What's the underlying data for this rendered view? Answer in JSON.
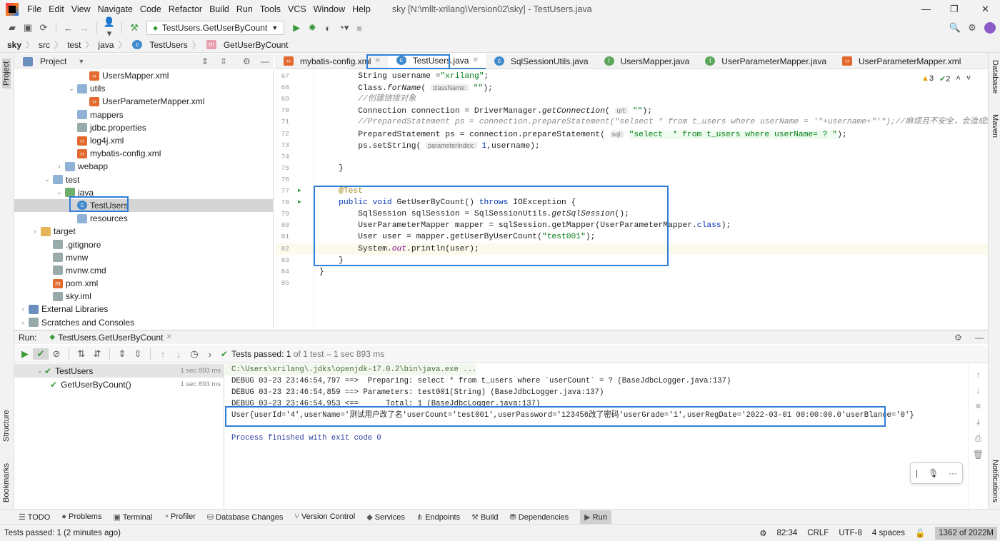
{
  "window": {
    "title": "sky [N:\\mllt-xrilang\\Version02\\sky] - TestUsers.java",
    "controls": [
      "—",
      "❐",
      "✕"
    ]
  },
  "menu": [
    "File",
    "Edit",
    "View",
    "Navigate",
    "Code",
    "Refactor",
    "Build",
    "Run",
    "Tools",
    "VCS",
    "Window",
    "Help"
  ],
  "toolbar": {
    "run_config": "TestUsers.GetUserByCount"
  },
  "breadcrumb": [
    "sky",
    "src",
    "test",
    "java",
    "TestUsers",
    "GetUserByCount"
  ],
  "left_strip": {
    "project": "Project",
    "structure": "Structure",
    "bookmarks": "Bookmarks"
  },
  "right_strip": {
    "database": "Database",
    "maven": "Maven",
    "notifications": "Notifications"
  },
  "project_panel": {
    "title": "Project",
    "tree": [
      {
        "label": "UsersMapper.xml",
        "indent": 5,
        "icon": "xml"
      },
      {
        "label": "utils",
        "indent": 4,
        "icon": "folder",
        "arrow": "open"
      },
      {
        "label": "UserParameterMapper.xml",
        "indent": 5,
        "icon": "xml"
      },
      {
        "label": "mappers",
        "indent": 4,
        "icon": "folder"
      },
      {
        "label": "jdbc.properties",
        "indent": 4,
        "icon": "file"
      },
      {
        "label": "log4j.xml",
        "indent": 4,
        "icon": "xml"
      },
      {
        "label": "mybatis-config.xml",
        "indent": 4,
        "icon": "xml"
      },
      {
        "label": "webapp",
        "indent": 3,
        "icon": "folder",
        "arrow": "closed"
      },
      {
        "label": "test",
        "indent": 2,
        "icon": "folder",
        "arrow": "open"
      },
      {
        "label": "java",
        "indent": 3,
        "icon": "folder-g",
        "arrow": "open"
      },
      {
        "label": "TestUsers",
        "indent": 4,
        "icon": "cls",
        "selected": true
      },
      {
        "label": "resources",
        "indent": 4,
        "icon": "folder"
      },
      {
        "label": "target",
        "indent": 1,
        "icon": "folder-y",
        "arrow": "closed"
      },
      {
        "label": ".gitignore",
        "indent": 2,
        "icon": "file"
      },
      {
        "label": "mvnw",
        "indent": 2,
        "icon": "file"
      },
      {
        "label": "mvnw.cmd",
        "indent": 2,
        "icon": "file"
      },
      {
        "label": "pom.xml",
        "indent": 2,
        "icon": "maven"
      },
      {
        "label": "sky.iml",
        "indent": 2,
        "icon": "file"
      },
      {
        "label": "External Libraries",
        "indent": 0,
        "icon": "lib",
        "arrow": "closed"
      },
      {
        "label": "Scratches and Consoles",
        "indent": 0,
        "icon": "file",
        "arrow": "closed"
      }
    ]
  },
  "editor": {
    "tabs": [
      {
        "label": "mybatis-config.xml",
        "icon": "xml"
      },
      {
        "label": "TestUsers.java",
        "icon": "cls",
        "active": true
      },
      {
        "label": "SqlSessionUtils.java",
        "icon": "cls"
      },
      {
        "label": "UsersMapper.java",
        "icon": "iface"
      },
      {
        "label": "UserParameterMapper.java",
        "icon": "iface"
      },
      {
        "label": "UserParameterMapper.xml",
        "icon": "xml"
      }
    ],
    "inspections": {
      "warnings": "3",
      "ok": "2"
    },
    "lines": [
      {
        "n": "67",
        "s": [
          [
            "        String username =",
            ""
          ],
          [
            "\"xrilang\"",
            "str"
          ],
          [
            ";",
            ""
          ]
        ]
      },
      {
        "n": "68",
        "s": [
          [
            "        Class.",
            ""
          ],
          [
            "forName",
            "it"
          ],
          [
            "( ",
            ""
          ],
          [
            "className:",
            "hint"
          ],
          [
            " ",
            ""
          ],
          [
            "\"\"",
            "str"
          ],
          [
            ");",
            ""
          ]
        ]
      },
      {
        "n": "69",
        "s": [
          [
            "        //创建链接对象",
            "cmt"
          ]
        ]
      },
      {
        "n": "70",
        "s": [
          [
            "        Connection connection = DriverManager.",
            ""
          ],
          [
            "getConnection",
            "it"
          ],
          [
            "( ",
            ""
          ],
          [
            "url:",
            "hint"
          ],
          [
            " ",
            ""
          ],
          [
            "\"\"",
            "str"
          ],
          [
            ");",
            ""
          ]
        ]
      },
      {
        "n": "71",
        "s": [
          [
            "        //PreparedStatement ps = connection.prepareStatement(\"selsect * from t_users where userName = '\"+username+\"'\");//麻烦且不安全，会造成SQL注入",
            "cmt"
          ]
        ]
      },
      {
        "n": "72",
        "s": [
          [
            "        PreparedStatement ps = connection.prepareStatement( ",
            ""
          ],
          [
            "sql:",
            "hint"
          ],
          [
            " ",
            ""
          ],
          [
            "\"select  * from t_users where userName= ? \"",
            "str sqlbg"
          ],
          [
            ");",
            ""
          ]
        ]
      },
      {
        "n": "73",
        "s": [
          [
            "        ps.setString( ",
            ""
          ],
          [
            "parameterIndex:",
            "hint"
          ],
          [
            " ",
            ""
          ],
          [
            "1",
            "kw"
          ],
          [
            ",username);",
            ""
          ]
        ]
      },
      {
        "n": "74",
        "s": []
      },
      {
        "n": "75",
        "s": [
          [
            "    }",
            ""
          ]
        ]
      },
      {
        "n": "76",
        "s": []
      },
      {
        "n": "77",
        "s": [
          [
            "    @Test",
            "ann"
          ]
        ]
      },
      {
        "n": "78",
        "s": [
          [
            "    ",
            ""
          ],
          [
            "public void ",
            "kw"
          ],
          [
            "GetUserByCount() ",
            ""
          ],
          [
            "throws ",
            "kw"
          ],
          [
            "IOException {",
            ""
          ]
        ]
      },
      {
        "n": "79",
        "s": [
          [
            "        SqlSession sqlSession = SqlSessionUtils.",
            ""
          ],
          [
            "getSqlSession",
            "it"
          ],
          [
            "();",
            ""
          ]
        ]
      },
      {
        "n": "80",
        "s": [
          [
            "        UserParameterMapper mapper = sqlSession.getMapper(UserParameterMapper.",
            ""
          ],
          [
            "class",
            "kw"
          ],
          [
            ");",
            ""
          ]
        ]
      },
      {
        "n": "81",
        "s": [
          [
            "        User user = mapper.getUserByUserCount(",
            ""
          ],
          [
            "\"test001\"",
            "str"
          ],
          [
            ");",
            ""
          ]
        ]
      },
      {
        "n": "82",
        "s": [
          [
            "        System.",
            ""
          ],
          [
            "out",
            "fld"
          ],
          [
            ".println(user);",
            ""
          ]
        ],
        "current": true
      },
      {
        "n": "83",
        "s": [
          [
            "    }",
            ""
          ]
        ]
      },
      {
        "n": "84",
        "s": [
          [
            "}",
            ""
          ]
        ]
      },
      {
        "n": "85",
        "s": []
      }
    ]
  },
  "run": {
    "label": "Run:",
    "tab": "TestUsers.GetUserByCount",
    "status_prefix": "Tests passed:",
    "status_count": "1",
    "status_suffix": "of 1 test – 1 sec 893 ms",
    "tree": [
      {
        "label": "TestUsers",
        "time": "1 sec 893 ms",
        "indent": 0
      },
      {
        "label": "GetUserByCount()",
        "time": "1 sec 893 ms",
        "indent": 1
      }
    ],
    "console": [
      {
        "t": "C:\\Users\\xrilang\\.jdks\\openjdk-17.0.2\\bin\\java.exe ...",
        "c": "c-cmd"
      },
      {
        "t": "DEBUG 03-23 23:46:54,797 ==>  Preparing: select * from t_users where `userCount` = ? (BaseJdbcLogger.java:137)",
        "c": ""
      },
      {
        "t": "DEBUG 03-23 23:46:54,859 ==> Parameters: test001(String) (BaseJdbcLogger.java:137)",
        "c": ""
      },
      {
        "t": "DEBUG 03-23 23:46:54,953 <==      Total: 1 (BaseJdbcLogger.java:137)",
        "c": ""
      },
      {
        "t": "User{userId='4',userName='测试用户改了名'userCount='test001',userPassword='123456改了密码'userGrade='1',userRegDate='2022-03-01 00:00:00.0'userBlance='0'}",
        "c": ""
      },
      {
        "t": "",
        "c": ""
      },
      {
        "t": "Process finished with exit code 0",
        "c": "c-blue"
      }
    ]
  },
  "bottom_tabs": [
    "TODO",
    "Problems",
    "Terminal",
    "Profiler",
    "Database Changes",
    "Version Control",
    "Services",
    "Endpoints",
    "Build",
    "Dependencies",
    "Run"
  ],
  "status": {
    "message": "Tests passed: 1 (2 minutes ago)",
    "position": "82:34",
    "line_sep": "CRLF",
    "encoding": "UTF-8",
    "indent": "4 spaces",
    "memory": "1362 of 2022M"
  },
  "colors": {
    "accent": "#2f7ed8",
    "pass": "#3c9a3c"
  }
}
